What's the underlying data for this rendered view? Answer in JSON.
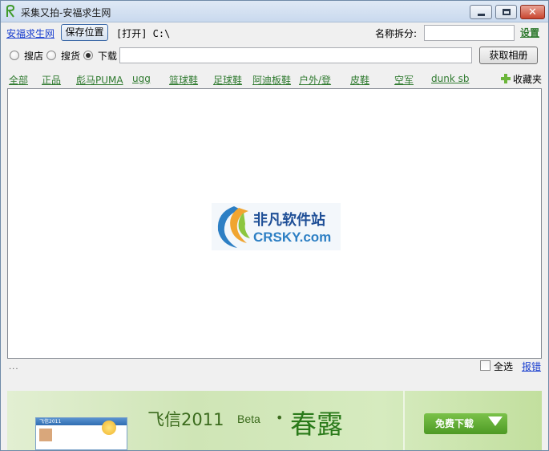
{
  "window": {
    "title": "采集又拍-安福求生网",
    "controls": [
      "minimize",
      "maximize",
      "close"
    ]
  },
  "toolbar": {
    "site_link": "安福求生网",
    "save_location_label": "保存位置",
    "open_text": "[打开] C:\\",
    "name_split_label": "名称拆分:",
    "name_split_value": "",
    "settings_link": "设置"
  },
  "search": {
    "options": [
      {
        "label": "搜店",
        "checked": false
      },
      {
        "label": "搜货",
        "checked": false
      },
      {
        "label": "下载",
        "checked": true
      }
    ],
    "url_value": "",
    "fetch_button_label": "获取相册"
  },
  "categories": [
    "全部",
    "正品",
    "彪马PUMA",
    "ugg",
    "篮球鞋",
    "足球鞋",
    "阿迪板鞋",
    "户外/登",
    "皮鞋",
    "空军",
    "dunk sb"
  ],
  "favorites_label": "收藏夹",
  "main": {
    "logo_cn": "非凡软件站",
    "logo_en": "CRSKY.com"
  },
  "status": {
    "dots": "...",
    "select_all_label": "全选",
    "select_all_checked": false,
    "report_link": "报错"
  },
  "banner": {
    "window_title": "飞信2011",
    "title": "飞信2011",
    "beta": "Beta",
    "bullet": "•",
    "spring": "春露",
    "download_button": "免费下载"
  },
  "colors": {
    "title_bar": "#c9d9ee",
    "link_blue": "#1a3fcf",
    "category_green": "#2f7a2f",
    "close_red": "#c9452f",
    "banner_green": "#cfe5b6"
  }
}
